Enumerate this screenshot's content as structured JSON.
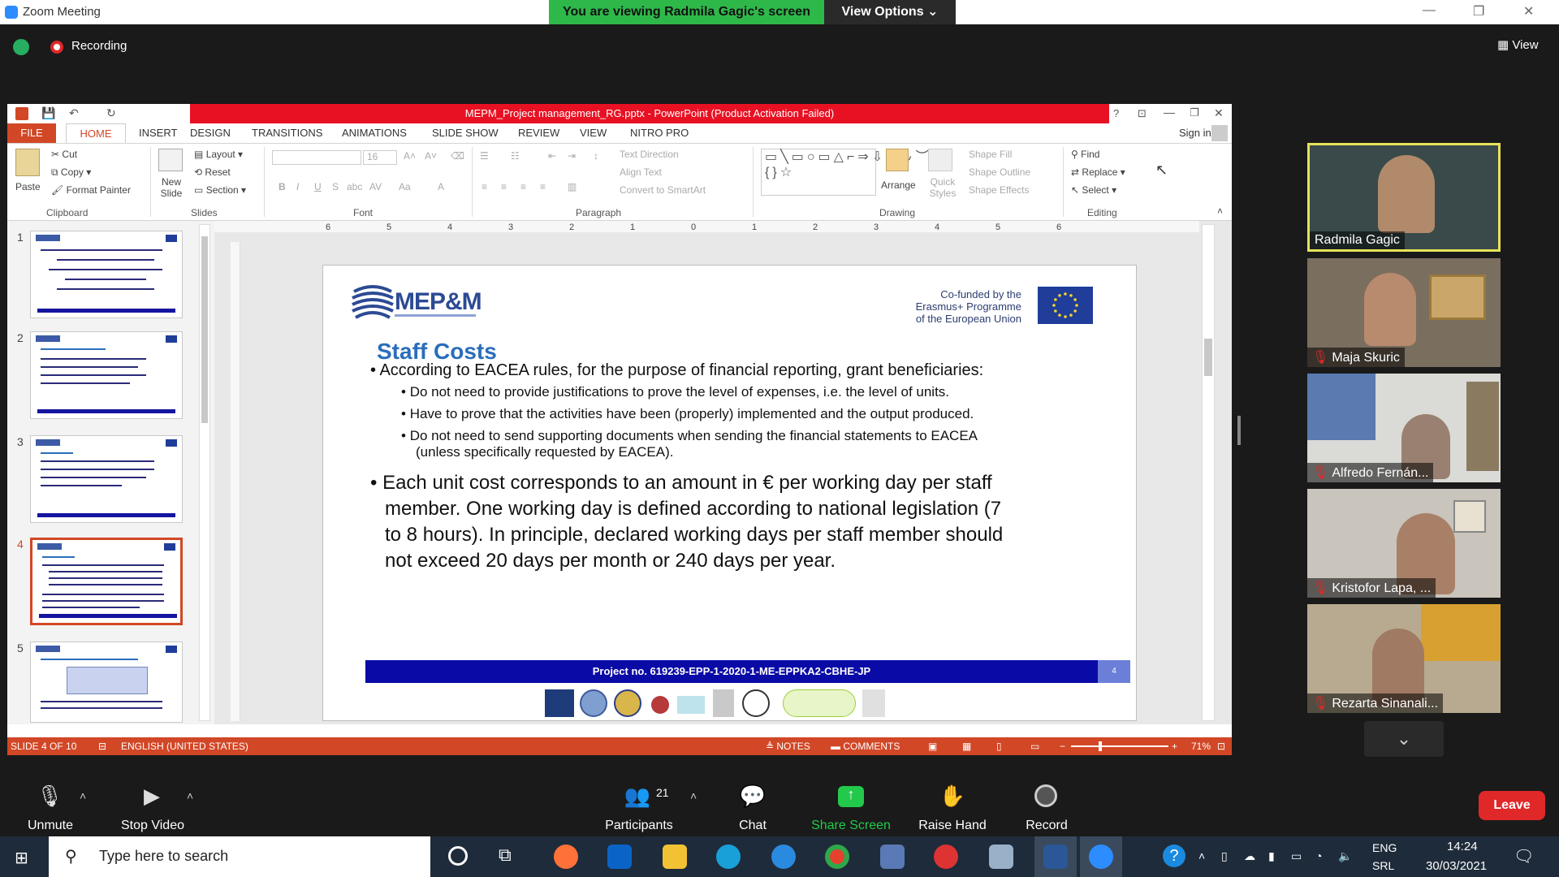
{
  "zoom": {
    "window_title": "Zoom Meeting",
    "viewing_banner": "You are viewing Radmila Gagic's screen",
    "view_options": "View Options",
    "recording_label": "Recording",
    "view_label": "View",
    "leave_label": "Leave",
    "toolbar": [
      {
        "label": "Unmute",
        "icon": "mic-off-icon"
      },
      {
        "label": "Stop Video",
        "icon": "video-icon"
      },
      {
        "label": "Participants",
        "icon": "participants-icon",
        "count": "21"
      },
      {
        "label": "Chat",
        "icon": "chat-icon"
      },
      {
        "label": "Share Screen",
        "icon": "share-screen-icon"
      },
      {
        "label": "Raise Hand",
        "icon": "raise-hand-icon"
      },
      {
        "label": "Record",
        "icon": "record-icon"
      }
    ],
    "participants": [
      {
        "name": "Radmila Gagic",
        "muted": false,
        "active": true
      },
      {
        "name": "Maja Skuric",
        "muted": true
      },
      {
        "name": "Alfredo Fernán...",
        "muted": true
      },
      {
        "name": "Kristofor Lapa, ...",
        "muted": true
      },
      {
        "name": "Rezarta Sinanali...",
        "muted": true
      }
    ]
  },
  "ppt": {
    "title": "MEPM_Project management_RG.pptx - PowerPoint (Product Activation Failed)",
    "sign_in": "Sign in",
    "tabs": [
      "FILE",
      "HOME",
      "INSERT",
      "DESIGN",
      "TRANSITIONS",
      "ANIMATIONS",
      "SLIDE SHOW",
      "REVIEW",
      "VIEW",
      "NITRO PRO"
    ],
    "ribbon": {
      "clipboard": {
        "group": "Clipboard",
        "paste": "Paste",
        "cut": "Cut",
        "copy": "Copy",
        "format_painter": "Format Painter"
      },
      "slides": {
        "group": "Slides",
        "new_slide": "New Slide",
        "layout": "Layout",
        "reset": "Reset",
        "section": "Section"
      },
      "font": {
        "group": "Font",
        "size": "16"
      },
      "paragraph": {
        "group": "Paragraph",
        "text_direction": "Text Direction",
        "align_text": "Align Text",
        "convert": "Convert to SmartArt"
      },
      "drawing": {
        "group": "Drawing",
        "arrange": "Arrange",
        "quick_styles": "Quick Styles",
        "shape_fill": "Shape Fill",
        "shape_outline": "Shape Outline",
        "shape_effects": "Shape Effects"
      },
      "editing": {
        "group": "Editing",
        "find": "Find",
        "replace": "Replace",
        "select": "Select"
      }
    },
    "thumbnails": [
      "1",
      "2",
      "3",
      "4",
      "5"
    ],
    "selected_thumbnail": "4",
    "ruler_ticks": [
      "6",
      "5",
      "4",
      "3",
      "2",
      "1",
      "0",
      "1",
      "2",
      "3",
      "4",
      "5",
      "6"
    ],
    "slide": {
      "logo_text": "MEP&M",
      "eu_text_1": "Co-funded by the",
      "eu_text_2": "Erasmus+ Programme",
      "eu_text_3": "of the European Union",
      "title": "Staff Costs",
      "bullet1": "According to EACEA rules, for the purpose of financial reporting, grant beneficiaries:",
      "sub1": "Do not need to provide justifications to prove the level of expenses, i.e. the level of units.",
      "sub2": "Have to prove that the activities have been (properly) implemented and the output produced.",
      "sub3a": "Do not need to send supporting documents when sending the financial statements to EACEA",
      "sub3b": "(unless specifically requested by EACEA).",
      "bullet2_l1": "Each unit cost corresponds to an amount in € per working day per staff",
      "bullet2_l2": "member. One working day is defined according to national legislation (7",
      "bullet2_l3": "to 8 hours). In principle, declared working days per staff member should",
      "bullet2_l4": "not exceed 20 days per month or 240 days per year.",
      "project_bar": "Project no. 619239-EPP-1-2020-1-ME-EPPKA2-CBHE-JP",
      "page_num": "4"
    },
    "status": {
      "slide_of": "SLIDE 4 OF 10",
      "language": "ENGLISH (UNITED STATES)",
      "notes": "NOTES",
      "comments": "COMMENTS",
      "zoom": "71%"
    }
  },
  "taskbar": {
    "search_placeholder": "Type here to search",
    "lang_1": "ENG",
    "lang_2": "SRL",
    "time": "14:24",
    "date": "30/03/2021"
  }
}
